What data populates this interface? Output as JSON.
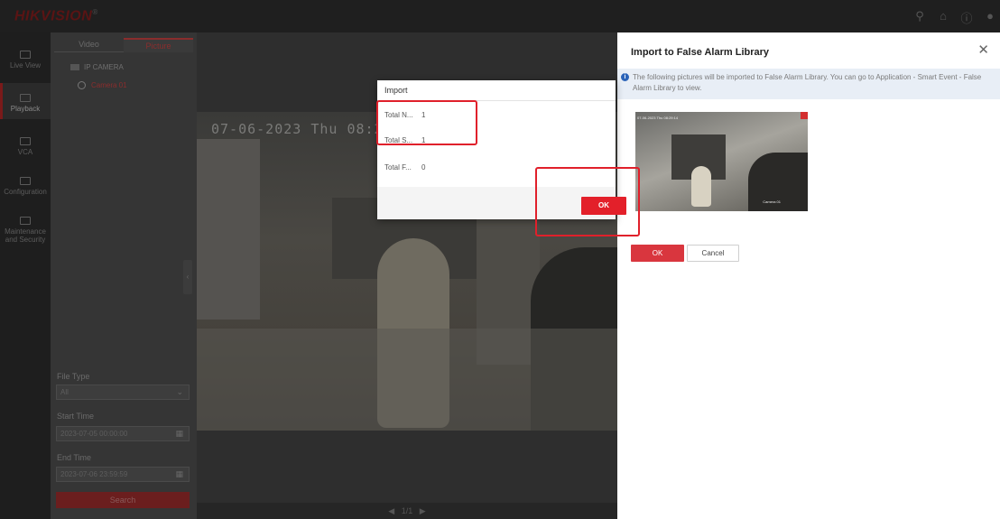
{
  "app": {
    "brand": "HIKVISION",
    "brand_mark": "®"
  },
  "topbar": {
    "icons": [
      "search-icon",
      "home-icon",
      "help-icon",
      "user-icon"
    ]
  },
  "leftnav": {
    "items": [
      {
        "label": "Live View",
        "icon": "monitor-icon"
      },
      {
        "label": "Playback",
        "icon": "playback-icon",
        "active": true
      },
      {
        "label": "VCA",
        "icon": "vca-icon"
      },
      {
        "label": "Configuration",
        "icon": "gear-icon"
      },
      {
        "label": "Maintenance and Security",
        "icon": "shield-icon"
      }
    ]
  },
  "sidepanel": {
    "tabs": [
      {
        "label": "Video"
      },
      {
        "label": "Picture",
        "active": true
      }
    ],
    "tree": {
      "root": "IP CAMERA",
      "child": "Camera 01"
    },
    "file_type": {
      "label": "File Type",
      "value": "All"
    },
    "start_time": {
      "label": "Start Time",
      "value": "2023-07-05 00:00:00"
    },
    "end_time": {
      "label": "End Time",
      "value": "2023-07-06 23:59:59"
    },
    "search_label": "Search"
  },
  "video": {
    "osd_text": "07-06-2023 Thu 08:29:14",
    "pager": "1/1"
  },
  "drawer": {
    "title": "Import to False Alarm Library",
    "info": "The following pictures will be imported to False Alarm Library. You can go to Application - Smart Event - False Alarm Library to view.",
    "thumb": {
      "osd": "07-06-2023 Thu 08:29:14",
      "camera": "Camera 01"
    },
    "ok_label": "OK",
    "cancel_label": "Cancel"
  },
  "dialog": {
    "title": "Import",
    "rows": [
      {
        "label": "Total N...",
        "value": "1"
      },
      {
        "label": "Total S...",
        "value": "1"
      },
      {
        "label": "Total F...",
        "value": "0"
      }
    ],
    "ok_label": "OK"
  },
  "colors": {
    "brand_red": "#e3202a",
    "highlight": "#e0202b",
    "info_blue": "#2b63b8"
  }
}
